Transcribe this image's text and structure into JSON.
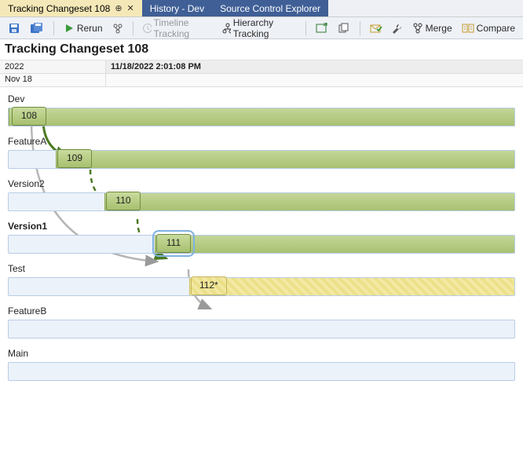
{
  "tabs": {
    "active": {
      "label": "Tracking Changeset 108"
    },
    "history": {
      "label": "History - Dev"
    },
    "sce": {
      "label": "Source Control Explorer"
    }
  },
  "toolbar": {
    "rerun_label": "Rerun",
    "timeline_label": "Timeline Tracking",
    "hierarchy_label": "Hierarchy Tracking",
    "merge_label": "Merge",
    "compare_label": "Compare"
  },
  "title": "Tracking Changeset 108",
  "header": {
    "year": "2022",
    "timestamp": "11/18/2022 2:01:08 PM",
    "day": "Nov 18"
  },
  "branches": {
    "dev": {
      "label": "Dev",
      "node": "108"
    },
    "featureA": {
      "label": "FeatureA",
      "node": "109"
    },
    "version2": {
      "label": "Version2",
      "node": "110"
    },
    "version1": {
      "label": "Version1",
      "node": "111"
    },
    "test": {
      "label": "Test",
      "node": "112*"
    },
    "featureB": {
      "label": "FeatureB"
    },
    "main": {
      "label": "Main"
    }
  },
  "chart_data": {
    "type": "timeline",
    "title": "Tracking Changeset 108",
    "timestamp": "11/18/2022 2:01:08 PM",
    "branches": [
      "Dev",
      "FeatureA",
      "Version2",
      "Version1",
      "Test",
      "FeatureB",
      "Main"
    ],
    "selected_branch": "Version1",
    "changesets": [
      {
        "id": 108,
        "branch": "Dev",
        "status": "merged"
      },
      {
        "id": 109,
        "branch": "FeatureA",
        "status": "merged"
      },
      {
        "id": 110,
        "branch": "Version2",
        "status": "merged"
      },
      {
        "id": 111,
        "branch": "Version1",
        "status": "merged",
        "selected": true
      },
      {
        "id": "112*",
        "branch": "Test",
        "status": "pending"
      }
    ],
    "merges": [
      {
        "from": 108,
        "to": 109,
        "kind": "direct"
      },
      {
        "from": 109,
        "to": 110,
        "kind": "baseless"
      },
      {
        "from": 110,
        "to": 111,
        "kind": "baseless"
      },
      {
        "from": 108,
        "to": 111,
        "kind": "indirect"
      },
      {
        "from": 111,
        "to": "112*",
        "kind": "indirect"
      }
    ],
    "legend_inferred": {
      "direct": "solid green arrow",
      "baseless": "dashed green arrow",
      "indirect": "gray arrow"
    }
  }
}
